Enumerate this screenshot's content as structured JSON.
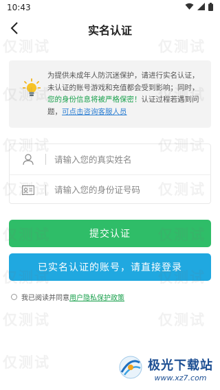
{
  "status_bar": {
    "time": "10:43"
  },
  "nav": {
    "title": "实名认证"
  },
  "notice": {
    "text_1": "为提供未成年人防沉迷保护，请进行实名认证，未认证的账号游戏和充值都会受到影响；同时，",
    "text_green": "您的身份信息将被严格保密！",
    "text_2": "认证过程若遇到问题，",
    "link": "可点击咨询客服人员"
  },
  "form": {
    "name_placeholder": "请输入您的真实姓名",
    "id_placeholder": "请输入您的身份证号码"
  },
  "buttons": {
    "submit_label": "提交认证",
    "login_label": "已实名认证的账号，请直接登录"
  },
  "agreement": {
    "prefix": "我已阅读并同意",
    "policy": "用户隐私保护政策"
  },
  "watermark": {
    "text": "仅测试"
  },
  "brand": {
    "name": "极光下载站",
    "url": "www.xz7.com"
  },
  "colors": {
    "primary_green": "#2fbd68",
    "primary_blue": "#20a8e0",
    "link_blue": "#2d7fd3"
  }
}
